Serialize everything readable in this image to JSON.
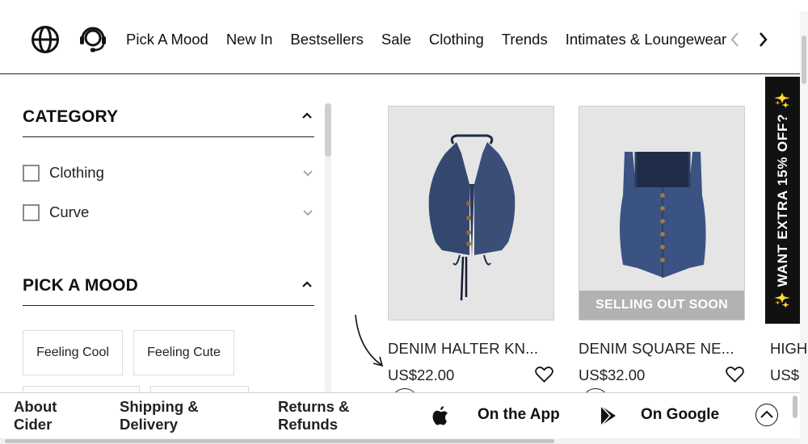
{
  "nav": {
    "links": [
      "Pick A Mood",
      "New In",
      "Bestsellers",
      "Sale",
      "Clothing",
      "Trends",
      "Intimates & Loungewear"
    ]
  },
  "sidebar": {
    "category": {
      "title": "CATEGORY",
      "items": [
        {
          "label": "Clothing"
        },
        {
          "label": "Curve"
        }
      ]
    },
    "mood": {
      "title": "PICK A MOOD",
      "items": [
        "Feeling Cool",
        "Feeling Cute"
      ]
    }
  },
  "products": [
    {
      "name": "DENIM HALTER KN...",
      "price": "US$22.00",
      "badge": ""
    },
    {
      "name": "DENIM SQUARE NE...",
      "price": "US$32.00",
      "badge": "SELLING OUT SOON"
    }
  ],
  "partial_product": {
    "name": "HIGH",
    "price": "US$"
  },
  "promo": {
    "spark": "✨",
    "text": "WANT EXTRA 15% OFF?"
  },
  "footer": {
    "about": [
      "About",
      "Cider"
    ],
    "shipping": [
      "Shipping &",
      "Delivery"
    ],
    "returns": [
      "Returns &",
      "Refunds"
    ],
    "app_label": "On the App",
    "google_label": "On Google"
  },
  "colors": {
    "denim": "#34476e",
    "badge": "#b2b2b2",
    "promo_bg": "#111111",
    "spark": "#f1c40f"
  }
}
